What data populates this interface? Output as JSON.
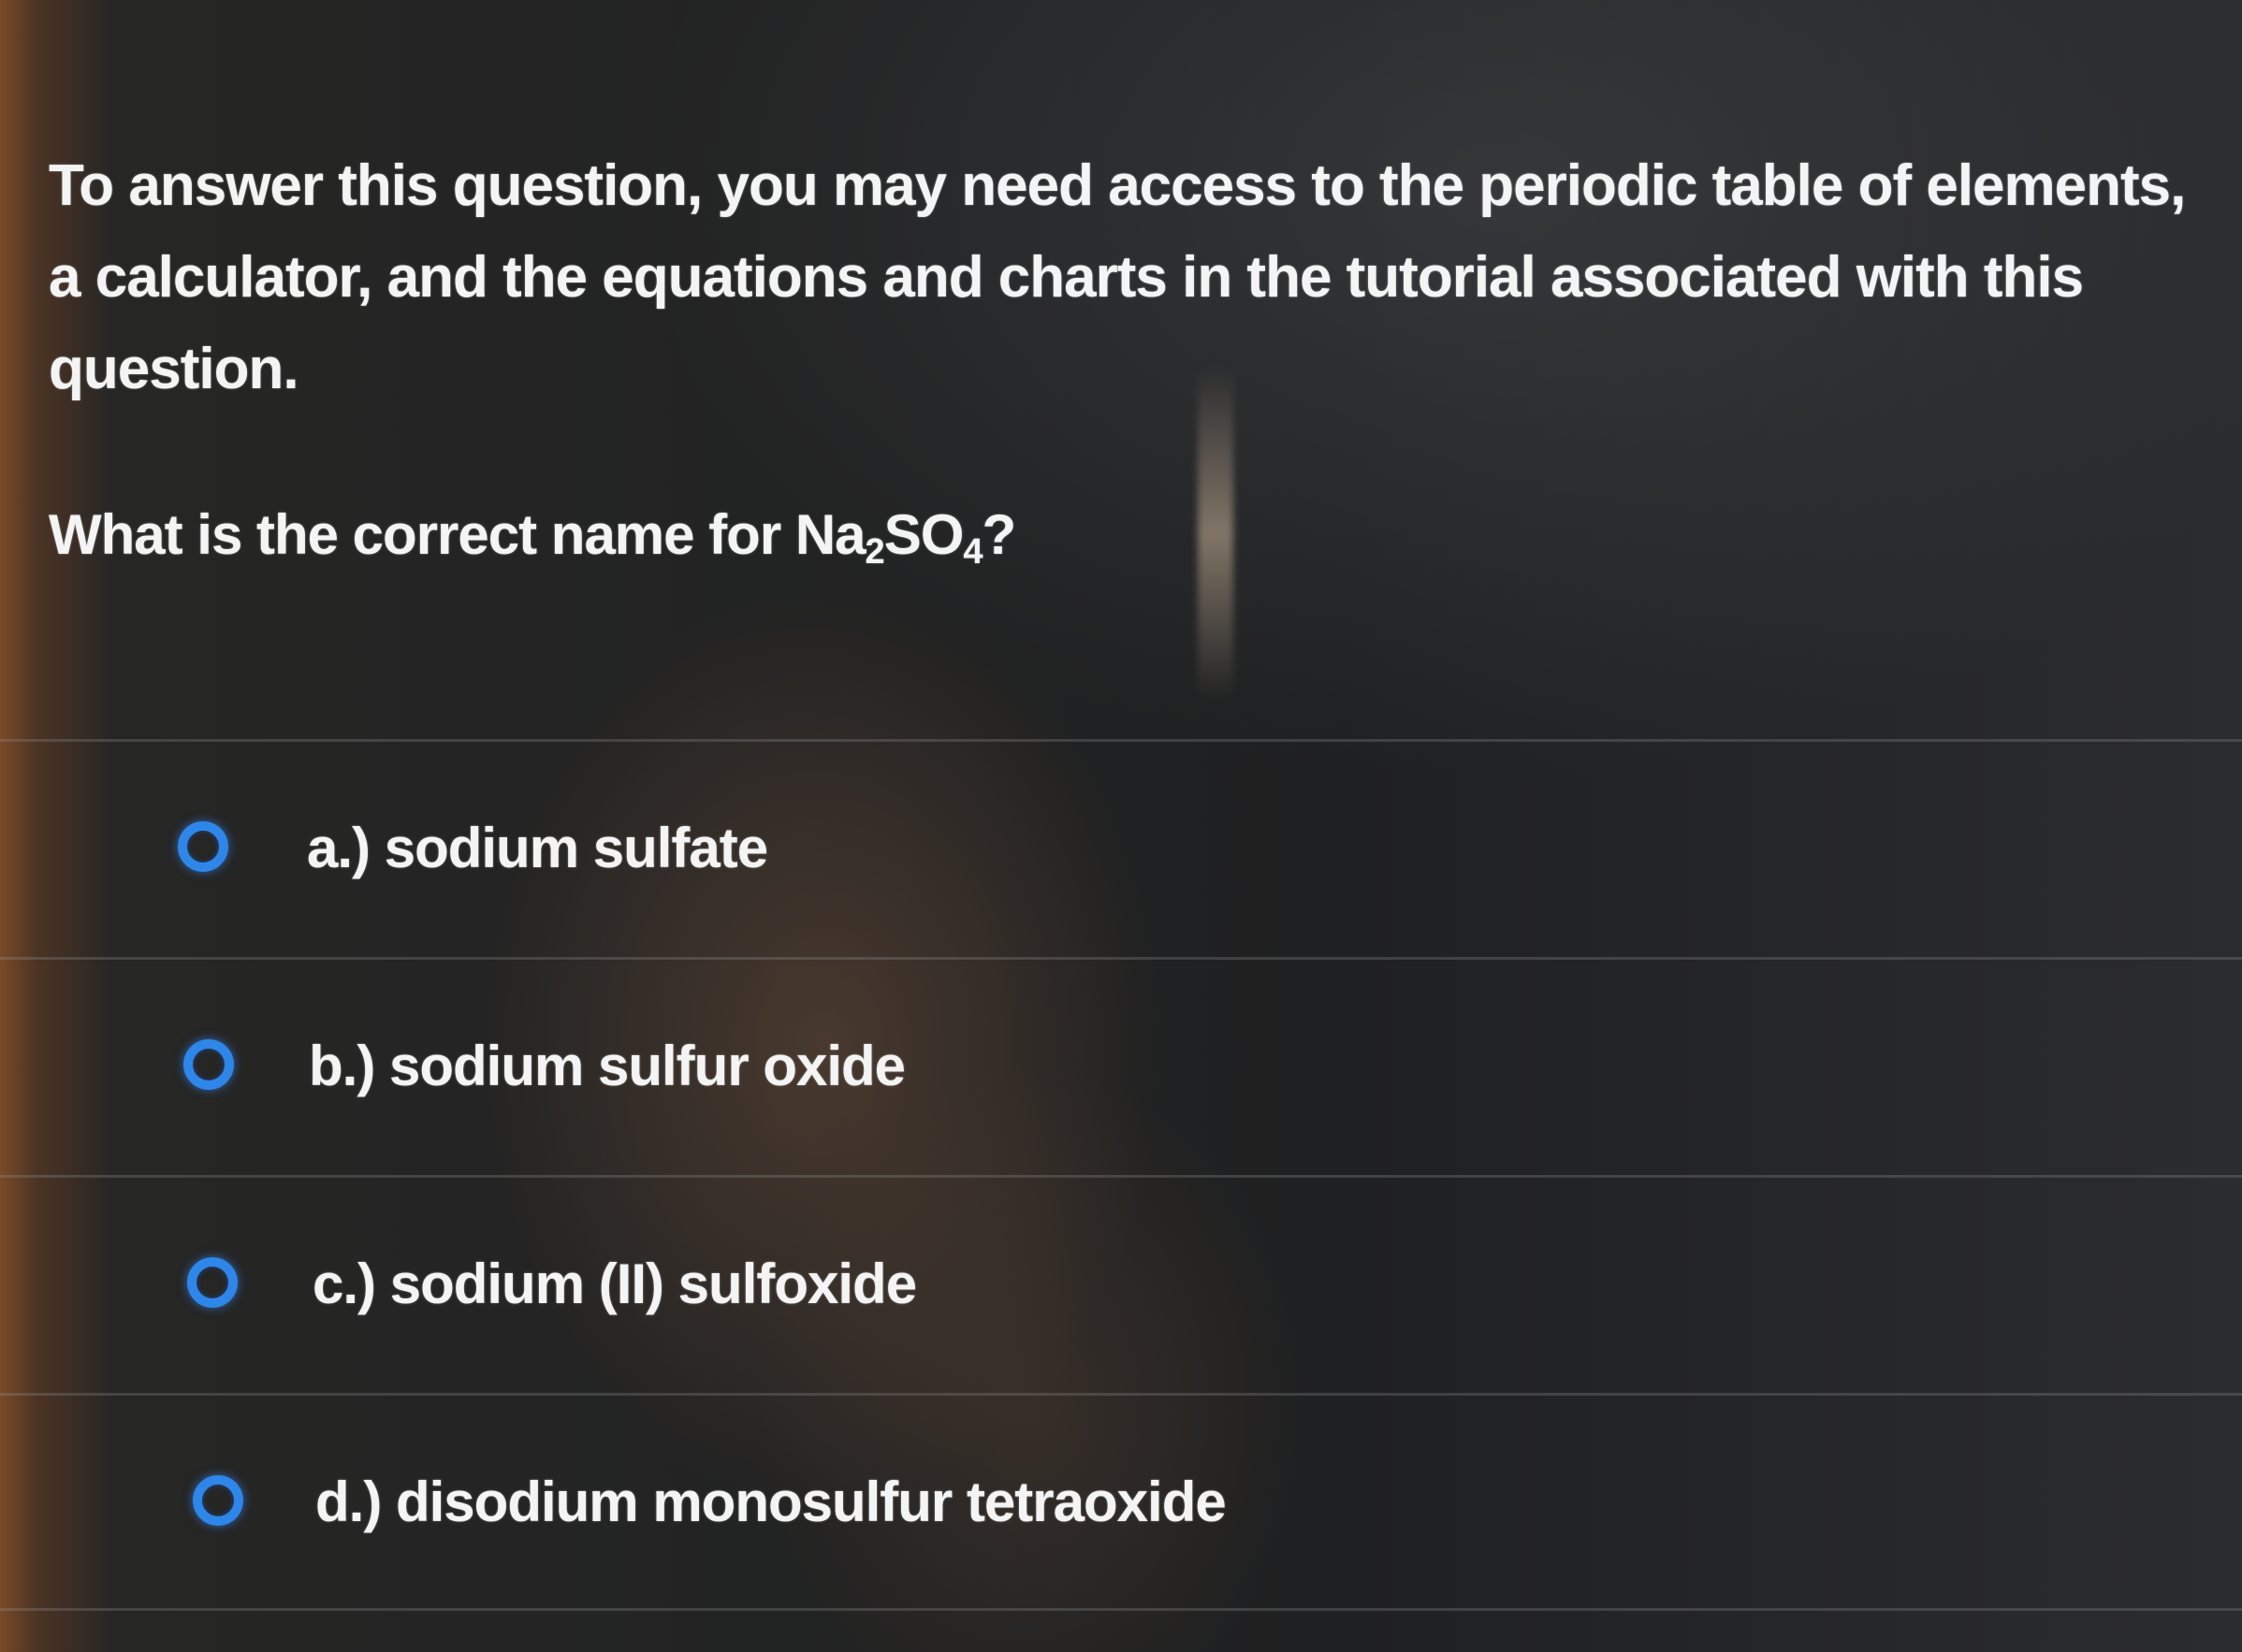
{
  "instructions": "To answer this question, you may need access to the periodic table of elements, a calculator, and the equations and charts in the tutorial associated with this question.",
  "question": {
    "prefix": "What is the correct name for Na",
    "sub1": "2",
    "middle": "SO",
    "sub2": "4",
    "suffix": "?"
  },
  "options": [
    {
      "letter": "a.)",
      "text": "sodium sulfate"
    },
    {
      "letter": "b.)",
      "text": "sodium sulfur oxide"
    },
    {
      "letter": "c.)",
      "text": "sodium (II) sulfoxide"
    },
    {
      "letter": "d.)",
      "text": "disodium monosulfur tetraoxide"
    }
  ],
  "colors": {
    "radio_accent": "#2f86e9",
    "text": "#f4f4f4",
    "background": "#222324"
  }
}
